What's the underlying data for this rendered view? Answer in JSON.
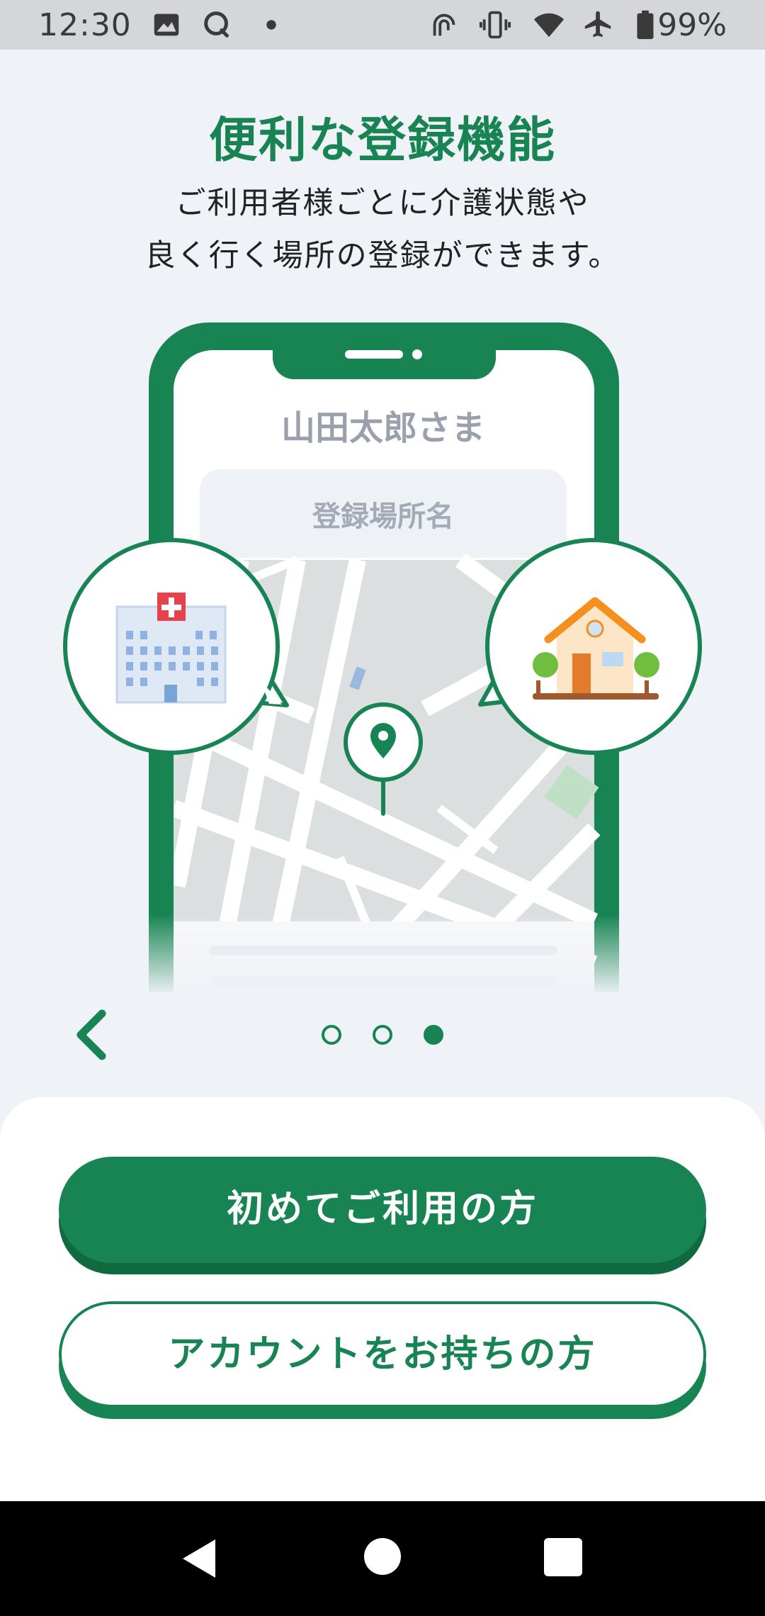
{
  "status_bar": {
    "time": "12:30",
    "battery_text": "99%",
    "icons": [
      "image-icon",
      "messaging-icon",
      "dot-icon",
      "nfc-icon",
      "vibrate-icon",
      "wifi-icon",
      "airplane-icon",
      "battery-icon"
    ]
  },
  "onboarding": {
    "title": "便利な登録機能",
    "subtitle_line1": "ご利用者様ごとに介護状態や",
    "subtitle_line2": "良く行く場所の登録ができます。",
    "phone_user_name": "山田太郎さま",
    "phone_place_placeholder": "登録場所名",
    "page_count": 3,
    "active_page": 3
  },
  "actions": {
    "primary_label": "初めてご利用の方",
    "secondary_label": "アカウントをお持ちの方"
  },
  "colors": {
    "brand_green": "#188453",
    "background": "#eff2f6",
    "nav_bar": "#000000"
  }
}
